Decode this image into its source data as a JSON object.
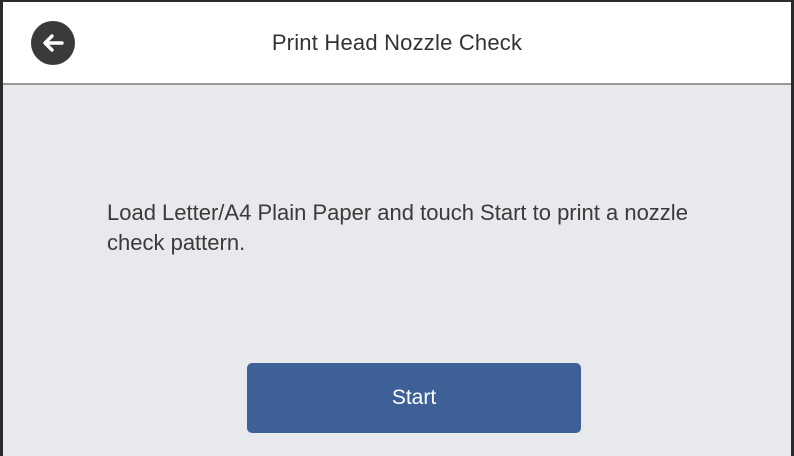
{
  "header": {
    "title": "Print Head Nozzle Check",
    "back_icon": "back-arrow-icon"
  },
  "main": {
    "message": "Load Letter/A4 Plain Paper and touch Start to print a nozzle check pattern."
  },
  "actions": {
    "start_label": "Start"
  },
  "colors": {
    "accent_button": "#3d6196",
    "background": "#e7e9ec",
    "header_background": "#ffffff",
    "back_button": "#3a3a3a"
  }
}
